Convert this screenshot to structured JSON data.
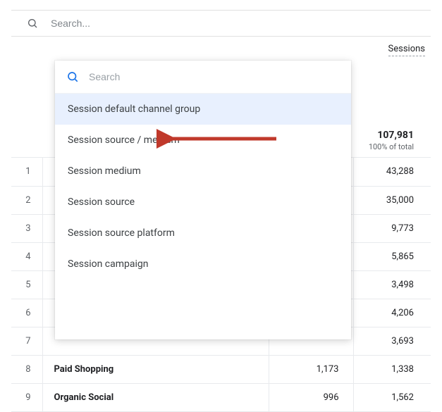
{
  "topSearch": {
    "placeholder": "Search..."
  },
  "header": {
    "sessions": "Sessions"
  },
  "totals": {
    "value": "107,981",
    "pct": "100% of total"
  },
  "rows": [
    {
      "idx": "1",
      "name": "",
      "col2": "",
      "col3": "43,288"
    },
    {
      "idx": "2",
      "name": "",
      "col2": "",
      "col3": "35,000"
    },
    {
      "idx": "3",
      "name": "",
      "col2": "",
      "col3": "9,773"
    },
    {
      "idx": "4",
      "name": "",
      "col2": "",
      "col3": "5,865"
    },
    {
      "idx": "5",
      "name": "",
      "col2": "",
      "col3": "3,498"
    },
    {
      "idx": "6",
      "name": "",
      "col2": "",
      "col3": "4,206"
    },
    {
      "idx": "7",
      "name": "",
      "col2": "",
      "col3": "3,693"
    },
    {
      "idx": "8",
      "name": "Paid Shopping",
      "col2": "1,173",
      "col3": "1,338"
    },
    {
      "idx": "9",
      "name": "Organic Social",
      "col2": "996",
      "col3": "1,562"
    }
  ],
  "dropdown": {
    "searchPlaceholder": "Search",
    "options": [
      {
        "label": "Session default channel group",
        "selected": true
      },
      {
        "label": "Session source / medium"
      },
      {
        "label": "Session medium"
      },
      {
        "label": "Session source"
      },
      {
        "label": "Session source platform"
      },
      {
        "label": "Session campaign"
      }
    ]
  },
  "annotation": {
    "arrowColor": "#c0392b"
  }
}
